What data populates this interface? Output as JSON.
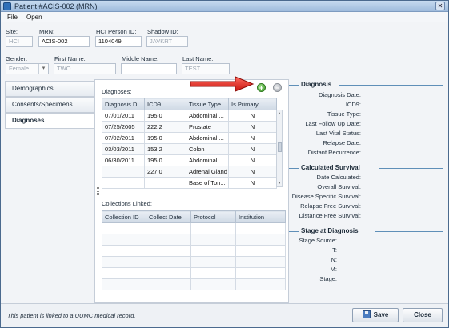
{
  "window": {
    "title": "Patient #ACIS-002 (MRN)",
    "close_glyph": "✕",
    "app_icon": "app-icon"
  },
  "menu": [
    "File",
    "Open"
  ],
  "header_fields": {
    "site": {
      "label": "Site:",
      "value": "HCI"
    },
    "mrn": {
      "label": "MRN:",
      "value": "ACIS-002"
    },
    "hci_person_id": {
      "label": "HCI Person ID:",
      "value": "1104049"
    },
    "shadow_id": {
      "label": "Shadow ID:",
      "value": "JAVKRT"
    },
    "gender": {
      "label": "Gender:",
      "value": "Female"
    },
    "first_name": {
      "label": "First Name:",
      "value": "TWO"
    },
    "middle_name": {
      "label": "Middle Name:",
      "value": ""
    },
    "last_name": {
      "label": "Last Name:",
      "value": "TEST"
    }
  },
  "nav": {
    "items": [
      {
        "label": "Demographics",
        "active": false
      },
      {
        "label": "Consents/Specimens",
        "active": false
      },
      {
        "label": "Diagnoses",
        "active": true
      }
    ]
  },
  "diagnoses": {
    "label": "Diagnoses:",
    "add_glyph": "+",
    "remove_glyph": "−",
    "columns": [
      "Diagnosis D...",
      "ICD9",
      "Tissue Type",
      "Is Primary"
    ],
    "rows": [
      [
        "07/01/2011",
        "195.0",
        "Abdominal ...",
        "N"
      ],
      [
        "07/25/2005",
        "222.2",
        "Prostate",
        "N"
      ],
      [
        "07/02/2011",
        "195.0",
        "Abdominal ...",
        "N"
      ],
      [
        "03/03/2011",
        "153.2",
        "Colon",
        "N"
      ],
      [
        "06/30/2011",
        "195.0",
        "Abdominal ...",
        "N"
      ],
      [
        "",
        "227.0",
        "Adrenal Gland",
        "N"
      ],
      [
        "",
        "",
        "Base of Ton...",
        "N"
      ]
    ]
  },
  "collections": {
    "label": "Collections Linked:",
    "columns": [
      "Collection ID",
      "Collect Date",
      "Protocol",
      "Institution"
    ],
    "empty_rows": 6
  },
  "diagnosis_panel": {
    "heading": "Diagnosis",
    "fields": [
      "Diagnosis Date:",
      "ICD9:",
      "Tissue Type:",
      "Last Follow Up Date:",
      "Last Vital Status:",
      "Relapse Date:",
      "Distant Recurrence:"
    ]
  },
  "survival_panel": {
    "heading": "Calculated Survival",
    "fields": [
      "Date Calculated:",
      "Overall Survival:",
      "Disease Specific Survival:",
      "Relapse Free Survival:",
      "Distance Free Survival:"
    ]
  },
  "stage_panel": {
    "heading": "Stage at Diagnosis",
    "fields": [
      "Stage Source:",
      "T:",
      "N:",
      "M:",
      "Stage:"
    ]
  },
  "footer": {
    "status": "This patient is linked to a UUMC medical record.",
    "save_label": "Save",
    "close_label": "Close"
  },
  "colors": {
    "accent_line": "#5f8fb8",
    "arrow": "#e3231f",
    "add_button": "#3f9a2a"
  }
}
